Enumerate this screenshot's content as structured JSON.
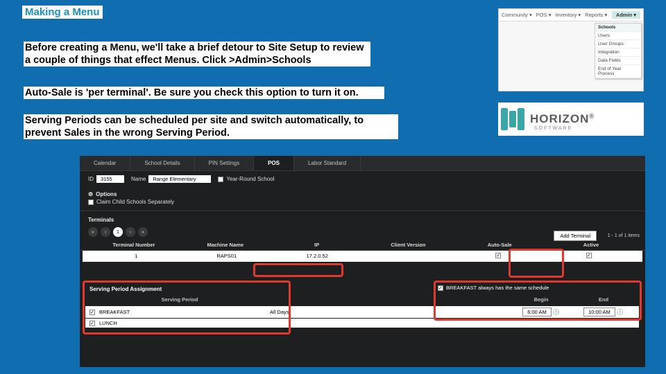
{
  "title": "Making a Menu",
  "para1": "Before creating a Menu, we'll take a brief detour to Site Setup to review a couple of things that effect Menus. Click >Admin>Schools",
  "para2": "Auto-Sale is 'per terminal'. Be sure you check this option to turn it on.",
  "para3": "Serving Periods can be scheduled per site and switch automatically, to prevent Sales in the wrong Serving Period.",
  "topnav": {
    "items": [
      "Community ▾",
      "POS ▾",
      "Inventory ▾",
      "Reports ▾"
    ],
    "admin": "Admin ▾",
    "dropdown": [
      "Schools",
      "Users",
      "User Groups",
      "Integration",
      "Data Fields",
      "End of Year Process"
    ]
  },
  "logo": {
    "brand": "HORIZON",
    "reg": "®",
    "sub": "SOFTWARE"
  },
  "panel": {
    "tabs": [
      "Calendar",
      "School Details",
      "PIN Settings",
      "POS",
      "Labor Standard"
    ],
    "active_tab": "POS",
    "id_label": "ID",
    "id_value": "3155",
    "name_label": "Name",
    "name_value": "Range Elementary",
    "year_round_label": "Year-Round School",
    "options_label": "Options",
    "claim_label": "Claim Child Schools Separately",
    "terminals_label": "Terminals",
    "add_terminal": "Add Terminal",
    "items_count": "1 - 1 of 1 items",
    "term_headers": [
      "Terminal Number",
      "Machine Name",
      "IP",
      "Client Version",
      "Auto-Sale",
      "Active"
    ],
    "term_row": {
      "num": "1",
      "machine": "RAPS01",
      "ip": "17.2.0.52",
      "ver": "",
      "auto": true,
      "active": true
    },
    "serving_title": "Serving Period Assignment",
    "serving_headers": {
      "period": "Serving Period",
      "begin": "Begin",
      "end": "End"
    },
    "same_sched": "BREAKFAST always has the same schedule",
    "serving_rows": [
      {
        "checked": true,
        "name": "BREAKFAST"
      },
      {
        "checked": true,
        "name": "LUNCH"
      }
    ],
    "all_days": "All Days",
    "begin_time": "6:00 AM",
    "end_time": "10:00 AM"
  }
}
